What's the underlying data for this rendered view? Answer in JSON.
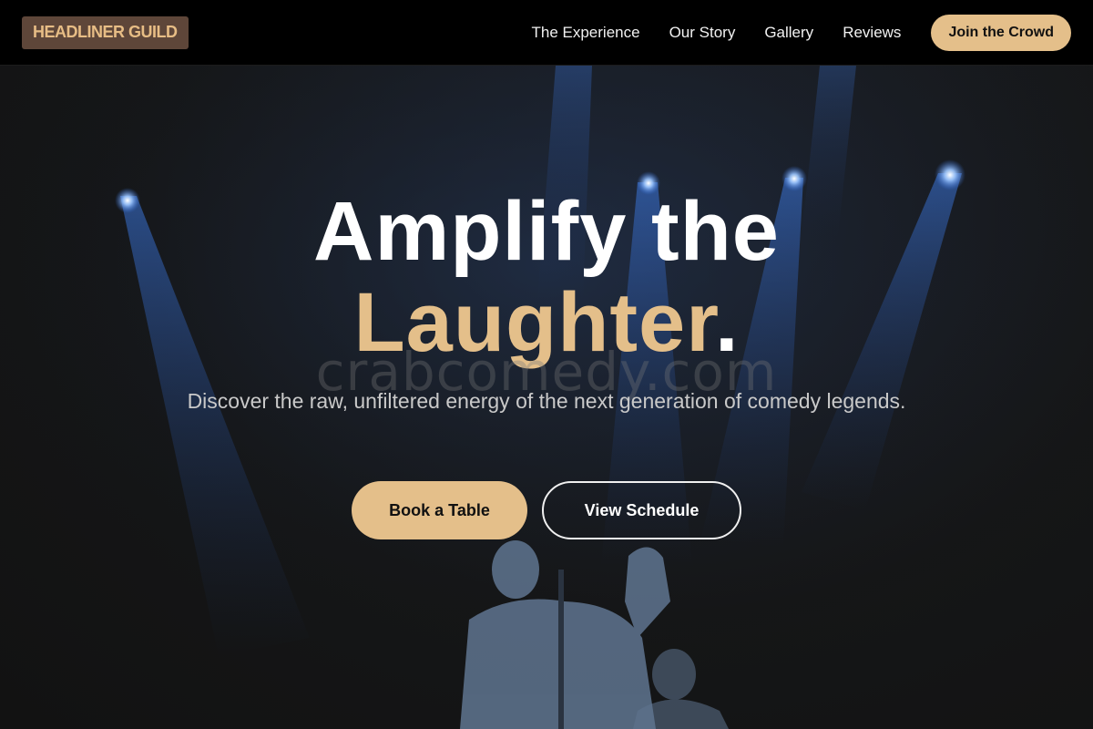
{
  "brand": {
    "logo_text": "HEADLINER GUILD"
  },
  "nav": {
    "links": [
      "The Experience",
      "Our Story",
      "Gallery",
      "Reviews"
    ],
    "cta_label": "Join the Crowd"
  },
  "hero": {
    "headline_line1": "Amplify the",
    "headline_line2": "Laughter",
    "headline_punct": ".",
    "watermark": "crabcomedy.com",
    "subtitle": "Discover the raw, unfiltered energy of the next generation of comedy legends.",
    "primary_cta": "Book a Table",
    "secondary_cta": "View Schedule",
    "background_image": "comedian-on-stage-with-microphone-and-spotlights"
  },
  "colors": {
    "accent": "#e4bf8a",
    "logo_bg": "#5e4639",
    "header_bg": "#000000",
    "page_bg": "#151515",
    "spotlight": "#3a73d6"
  }
}
